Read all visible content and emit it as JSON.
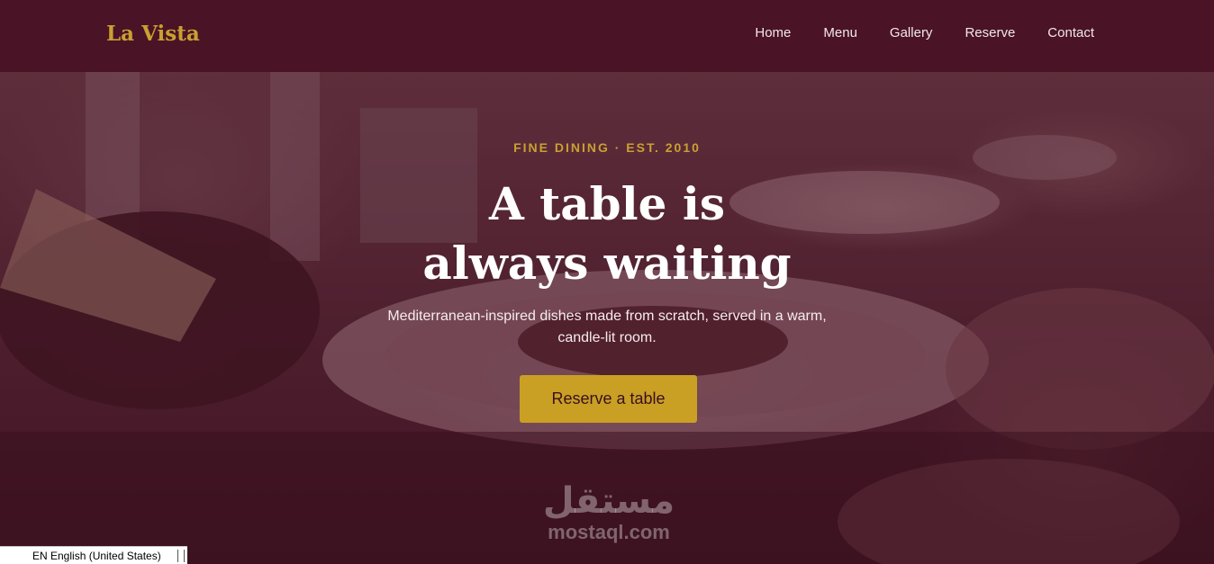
{
  "brand": {
    "name": "La Vista"
  },
  "nav": {
    "items": [
      {
        "label": "Home"
      },
      {
        "label": "Menu"
      },
      {
        "label": "Gallery"
      },
      {
        "label": "Reserve"
      },
      {
        "label": "Contact"
      }
    ]
  },
  "hero": {
    "eyebrow": "FINE DINING · EST. 2010",
    "headline_line1": "A table is",
    "headline_line2": "always waiting",
    "subtext": "Mediterranean-inspired dishes made from scratch, served in a warm, candle-lit room.",
    "cta_label": "Reserve a table"
  },
  "watermark": {
    "arabic": "مستقل",
    "latin": "mostaql.com"
  },
  "language_bar": {
    "label": "EN English (United States)"
  },
  "colors": {
    "brand_bg": "#4a1326",
    "accent_gold": "#c9a032",
    "button_gold": "#c9a024"
  }
}
